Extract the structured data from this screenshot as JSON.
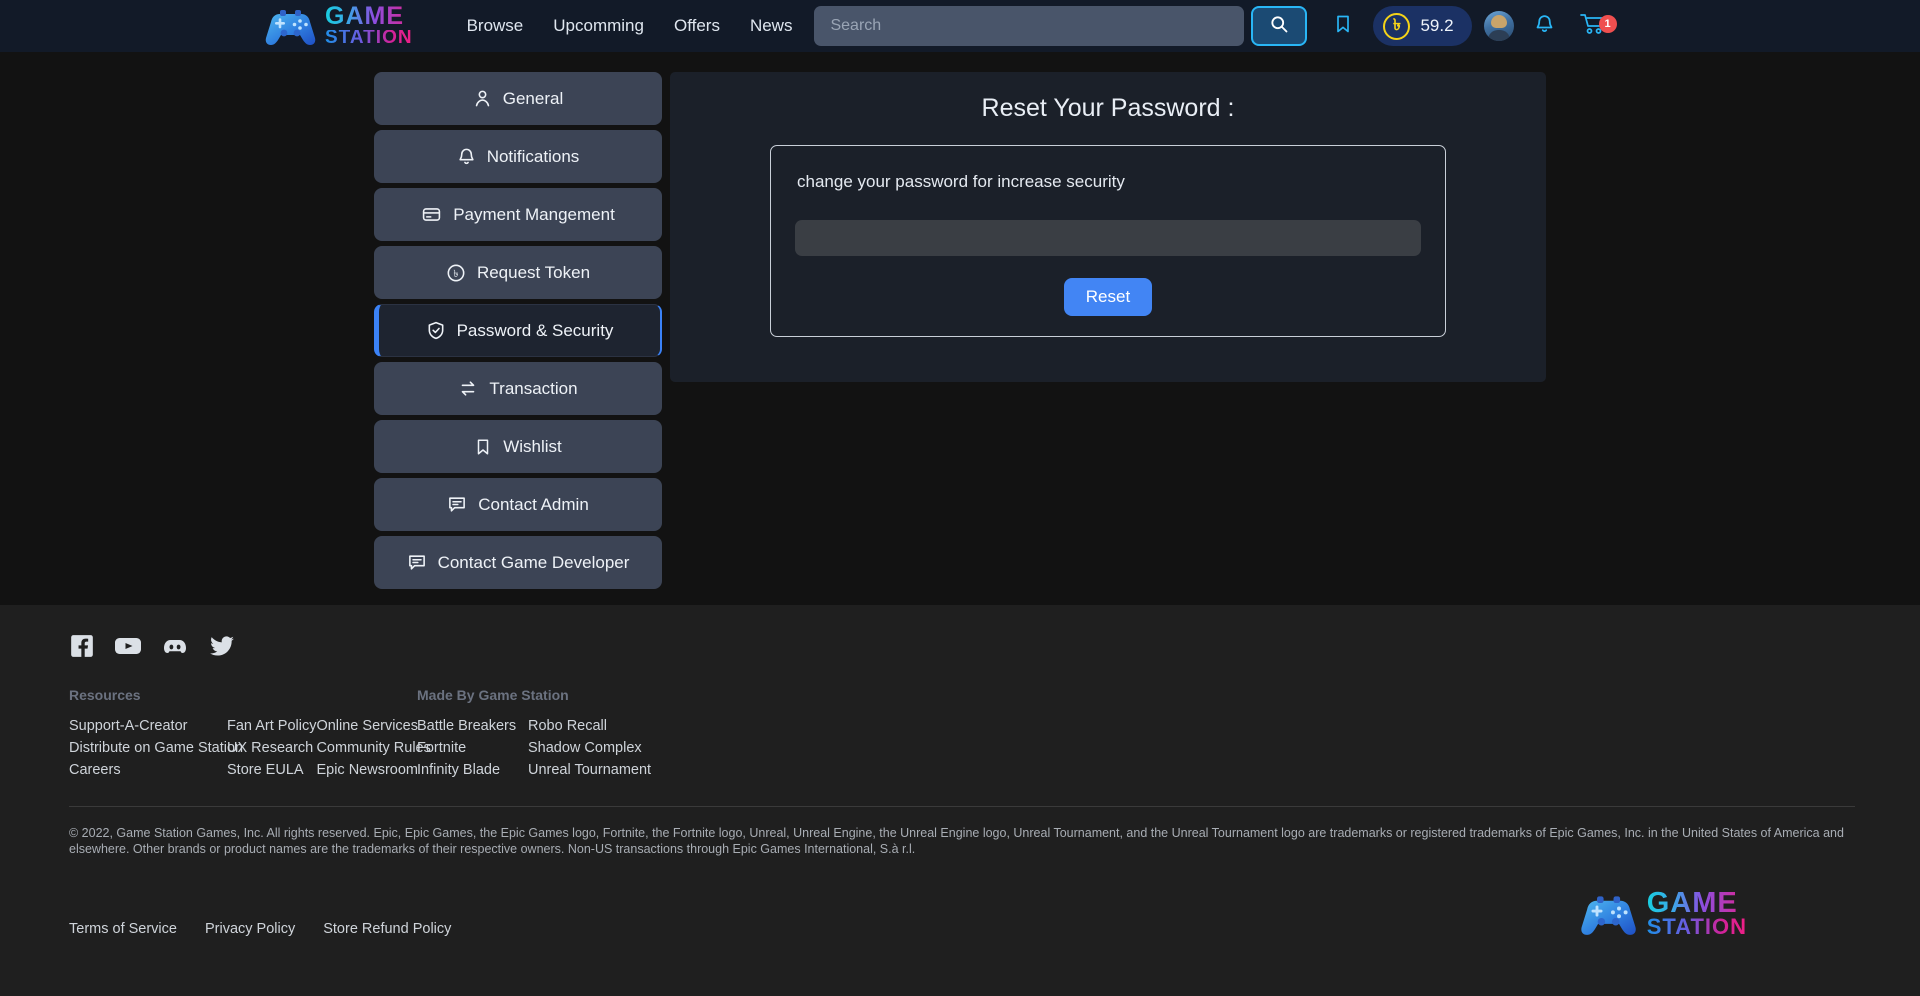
{
  "brand": {
    "logo_game": "GAME",
    "logo_station": "STATION",
    "controller_icon": "game-controller-icon"
  },
  "topnav": {
    "links": [
      {
        "label": "Browse"
      },
      {
        "label": "Upcomming"
      },
      {
        "label": "Offers"
      },
      {
        "label": "News"
      }
    ],
    "search": {
      "value": "",
      "placeholder": "Search"
    },
    "search_button_icon": "search-icon",
    "bookmark_icon": "bookmark-icon",
    "wallet": {
      "currency_symbol": "৳",
      "amount": "59.2"
    },
    "avatar_icon": "user-avatar",
    "notification_icon": "bell-icon",
    "cart_icon": "cart-icon",
    "cart_count": "1"
  },
  "sidebar": {
    "items": [
      {
        "label": "General",
        "icon": "user-icon",
        "active": false
      },
      {
        "label": "Notifications",
        "icon": "bell-icon",
        "active": false
      },
      {
        "label": "Payment Mangement",
        "icon": "credit-card-icon",
        "active": false
      },
      {
        "label": "Request Token",
        "icon": "taka-coin-icon",
        "active": false
      },
      {
        "label": "Password & Security",
        "icon": "shield-check-icon",
        "active": true
      },
      {
        "label": "Transaction",
        "icon": "transfer-arrows-icon",
        "active": false
      },
      {
        "label": "Wishlist",
        "icon": "bookmark-icon",
        "active": false
      },
      {
        "label": "Contact Admin",
        "icon": "chat-icon",
        "active": false
      },
      {
        "label": "Contact Game Developer",
        "icon": "chat-icon",
        "active": false
      }
    ]
  },
  "main": {
    "title": "Reset Your Password :",
    "description": "change your password for increase security",
    "password_field": {
      "value": "",
      "placeholder": ""
    },
    "reset_label": "Reset"
  },
  "footer": {
    "socials": [
      {
        "name": "facebook-icon"
      },
      {
        "name": "youtube-icon"
      },
      {
        "name": "discord-icon"
      },
      {
        "name": "twitter-icon"
      }
    ],
    "groups": [
      {
        "heading": "Resources",
        "columns": [
          [
            "Support-A-Creator",
            "Distribute on Game Station",
            "Careers"
          ],
          [
            "Fan Art Policy",
            "UX Research",
            "Store EULA"
          ],
          [
            "Online Services",
            "Community Rules",
            "Epic Newsroom"
          ]
        ]
      },
      {
        "heading": "Made By Game Station",
        "columns": [
          [
            "Battle Breakers",
            "Fortnite",
            "Infinity Blade"
          ],
          [
            "Robo Recall",
            "Shadow Complex",
            "Unreal Tournament"
          ]
        ]
      }
    ],
    "legal": "© 2022, Game Station Games, Inc. All rights reserved. Epic, Epic Games, the Epic Games logo, Fortnite, the Fortnite logo, Unreal, Unreal Engine, the Unreal Engine logo, Unreal Tournament, and the Unreal Tournament logo are trademarks or registered trademarks of Epic Games, Inc. in the United States of America and elsewhere. Other brands or product names are the trademarks of their respective owners. Non-US transactions through Epic Games International, S.à r.l.",
    "bottom_links": [
      {
        "label": "Terms of Service"
      },
      {
        "label": "Privacy Policy"
      },
      {
        "label": "Store Refund Policy"
      }
    ]
  },
  "colors": {
    "nav_bg": "#121a28",
    "page_bg": "#121212",
    "footer_bg": "#1f1f1f",
    "sidebar_item": "#3c4455",
    "accent_blue": "#3b82f6",
    "search_btn_border": "#29b6f6",
    "coin_yellow": "#f5d318",
    "cart_badge": "#ef4f4f"
  }
}
